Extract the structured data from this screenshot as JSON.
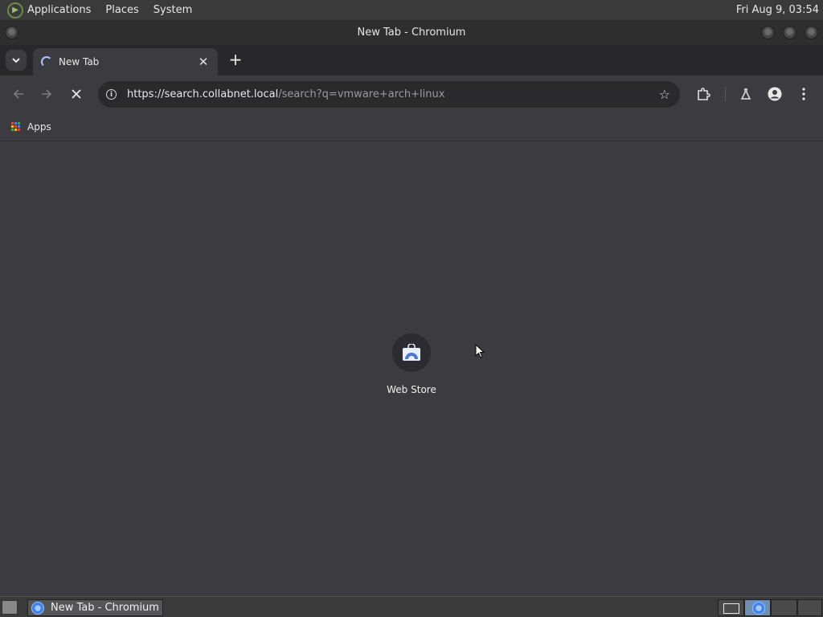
{
  "top_panel": {
    "menus": [
      "Applications",
      "Places",
      "System"
    ],
    "clock": "Fri Aug  9, 03:54"
  },
  "window": {
    "title": "New Tab - Chromium"
  },
  "tabs": [
    {
      "label": "New Tab",
      "loading": true
    }
  ],
  "toolbar": {
    "url_host": "https://search.collabnet.local",
    "url_path": "/search?q=vmware+arch+linux"
  },
  "bookmarks": {
    "apps_label": "Apps"
  },
  "content": {
    "shortcuts": [
      {
        "label": "Web Store",
        "icon": "web-store-icon"
      }
    ]
  },
  "taskbar": {
    "task_label": "New Tab - Chromium"
  },
  "colors": {
    "background": "#3c3c40",
    "accent": "#a8c7fa"
  }
}
